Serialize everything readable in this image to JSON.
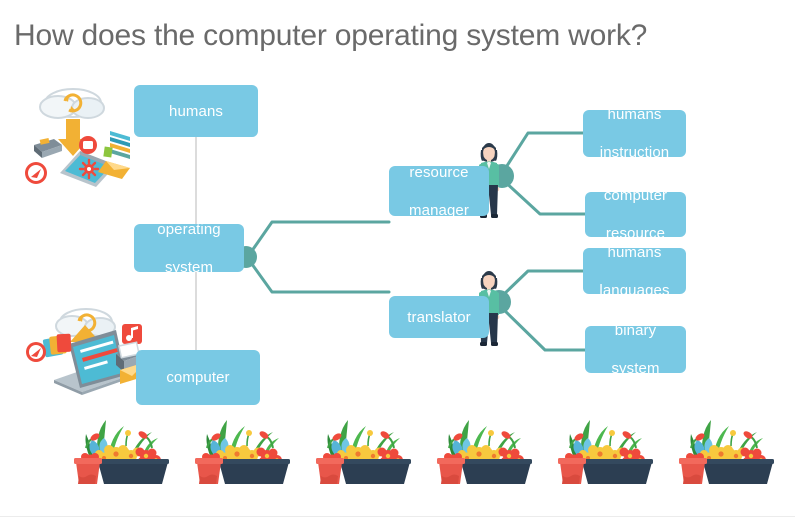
{
  "slide": {
    "title": "How does the computer operating system work?",
    "background_color": "#ffffff"
  },
  "theme": {
    "node_fill": "#79c9e4",
    "node_text": "#ffffff",
    "connector": "#5ba6a0",
    "node_dot": "#5ba6a0",
    "spine": "#dcdcdc",
    "title_text": "#6a6a6a",
    "planter_body": "#2c3e52",
    "planter_pot": "#e8564a",
    "leaf_green": "#3fa345",
    "flower_yellow": "#f7c93e",
    "flower_red": "#ef4a3c",
    "flower_blue": "#56b4d8"
  },
  "diagram": {
    "nodes": {
      "humans": "humans",
      "operating_system": "operating\nsystem",
      "operating_system_line1": "operating",
      "operating_system_line2": "system",
      "computer": "computer",
      "resource_manager_line1": "resource",
      "resource_manager_line2": "manager",
      "translator": "translator",
      "humans_instruction_line1": "humans",
      "humans_instruction_line2": "instruction",
      "computer_resource_line1": "computer",
      "computer_resource_line2": "resource",
      "humans_languages_line1": "humans",
      "humans_languages_line2": "languages",
      "binary_system_line1": "binary",
      "binary_system_line2": "system"
    }
  },
  "illustrations": {
    "cloud_mobile": "cloud-download-mobile-illustration",
    "laptop_cloud": "laptop-cloud-upload-illustration",
    "person_resource_manager": "person-standing-illustration",
    "person_translator": "person-standing-illustration",
    "planter": "flower-planter-illustration",
    "planter_count": 6
  }
}
